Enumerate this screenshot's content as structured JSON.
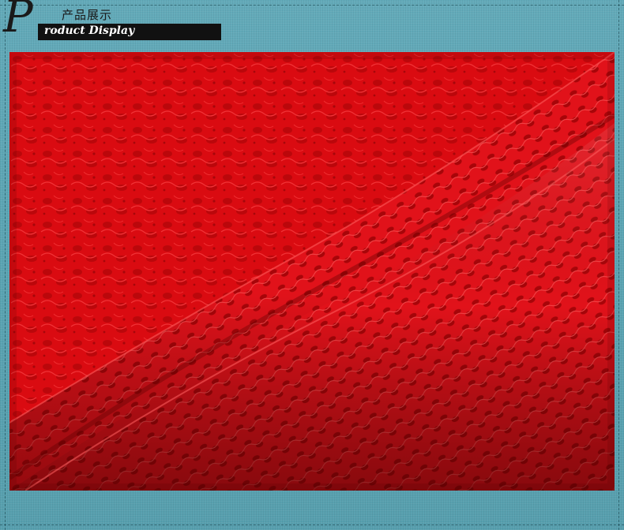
{
  "header": {
    "initial": "P",
    "title_cn": "产品展示",
    "title_en": "roduct Display"
  },
  "colors": {
    "background": "#5aa3b2",
    "banner": "#111111",
    "fabric": "#d80a10"
  },
  "photo": {
    "subject": "red lace fabric close-up"
  }
}
